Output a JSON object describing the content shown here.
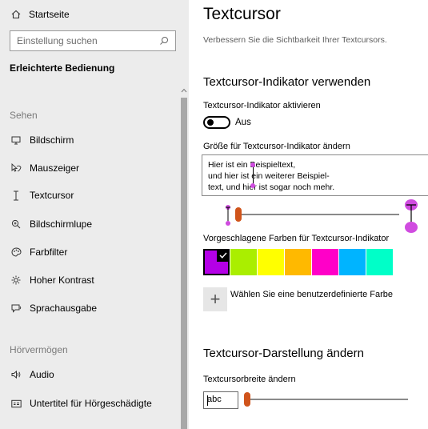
{
  "sidebar": {
    "home_label": "Startseite",
    "search_placeholder": "Einstellung suchen",
    "section_title": "Erleichterte Bedienung",
    "group_vision": "Sehen",
    "group_hearing": "Hörvermögen",
    "items": [
      {
        "label": "Bildschirm",
        "icon": "monitor-icon"
      },
      {
        "label": "Mauszeiger",
        "icon": "mouse-pointer-icon"
      },
      {
        "label": "Textcursor",
        "icon": "text-cursor-icon"
      },
      {
        "label": "Bildschirmlupe",
        "icon": "magnifier-icon"
      },
      {
        "label": "Farbfilter",
        "icon": "color-filter-icon"
      },
      {
        "label": "Hoher Kontrast",
        "icon": "contrast-sun-icon"
      },
      {
        "label": "Sprachausgabe",
        "icon": "narrator-icon"
      },
      {
        "label": "Audio",
        "icon": "speaker-icon"
      },
      {
        "label": "Untertitel für Hörgeschädigte",
        "icon": "captions-icon"
      }
    ]
  },
  "main": {
    "title": "Textcursor",
    "description": "Verbessern Sie die Sichtbarkeit Ihrer Textcursors.",
    "indicator_heading": "Textcursor-Indikator verwenden",
    "indicator_toggle_label": "Textcursor-Indikator aktivieren",
    "indicator_toggle_state": "Aus",
    "size_label": "Größe für Textcursor-Indikator ändern",
    "preview_lines": [
      "Hier ist ein Beispieltext,",
      "und hier ist ein weiterer Beispiel-",
      "text, und hier ist sogar noch mehr."
    ],
    "colors_label": "Vorgeschlagene Farben für Textcursor-Indikator",
    "swatches": [
      "#b400e6",
      "#aaee00",
      "#ffff00",
      "#ffb900",
      "#ff00c8",
      "#00b4ff",
      "#00ffc8"
    ],
    "selected_swatch": 0,
    "custom_color_label": "Wählen Sie eine benutzerdefinierte Farbe",
    "appearance_heading": "Textcursor-Darstellung ändern",
    "width_label": "Textcursorbreite ändern",
    "width_sample": "abc",
    "accent_color": "#d0541b",
    "indicator_color": "#d04ce0"
  }
}
